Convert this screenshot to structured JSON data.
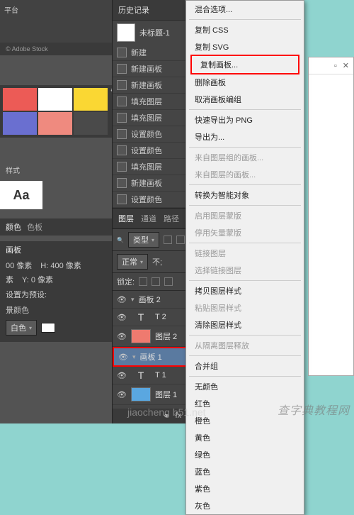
{
  "left": {
    "platform": "平台",
    "stock": "© Adobe Stock",
    "swatches": [
      "#ec5b56",
      "#ffffff",
      "#FAD733",
      "#6a6fd0",
      "#ef8a7f",
      "#4a4a4a"
    ],
    "fad_label": "#FAD733",
    "style_label": "样式",
    "aa": "Aa",
    "tabs_color": {
      "a": "颜色",
      "b": "色板"
    },
    "artboard_tab": "画板",
    "w_label": "00 像素",
    "h_label": "H: 400 像素",
    "x_label": "素",
    "y_label": "Y: 0 像素",
    "preset_label": "设置为预设:",
    "bg_label": "景颜色",
    "bg_value": "白色"
  },
  "history": {
    "title": "历史记录",
    "doc": "未标题-1",
    "items": [
      "新建",
      "新建画板",
      "新建画板",
      "填充图层",
      "填充图层",
      "设置颜色",
      "设置颜色",
      "填充图层",
      "新建画板",
      "设置颜色"
    ]
  },
  "layers": {
    "tabs": {
      "layer": "图层",
      "channel": "通道",
      "path": "路径"
    },
    "kind": "类型",
    "mode": "正常",
    "opacity_label": "不;",
    "lock": "锁定:",
    "items": [
      {
        "name": "画板 2",
        "type": "group"
      },
      {
        "name": "T 2",
        "type": "text"
      },
      {
        "name": "图层 2",
        "type": "layer",
        "color": "#ef7a6f"
      },
      {
        "name": "画板 1",
        "type": "group",
        "selected": true
      },
      {
        "name": "T 1",
        "type": "text"
      },
      {
        "name": "图层 1",
        "type": "layer",
        "color": "#5aa7e0"
      }
    ]
  },
  "ctx": {
    "items": [
      {
        "t": "混合选项...",
        "en": true
      },
      {
        "sep": true
      },
      {
        "t": "复制 CSS",
        "en": true
      },
      {
        "t": "复制 SVG",
        "en": true
      },
      {
        "t": "复制画板...",
        "en": true,
        "hl": true
      },
      {
        "t": "删除画板",
        "en": true
      },
      {
        "t": "取消画板编组",
        "en": true
      },
      {
        "sep": true
      },
      {
        "t": "快速导出为 PNG",
        "en": true
      },
      {
        "t": "导出为...",
        "en": true
      },
      {
        "sep": true
      },
      {
        "t": "来自图层组的画板...",
        "en": false
      },
      {
        "t": "来自图层的画板...",
        "en": false
      },
      {
        "sep": true
      },
      {
        "t": "转换为智能对象",
        "en": true
      },
      {
        "sep": true
      },
      {
        "t": "启用图层蒙版",
        "en": false
      },
      {
        "t": "停用矢量蒙版",
        "en": false
      },
      {
        "sep": true
      },
      {
        "t": "链接图层",
        "en": false
      },
      {
        "t": "选择链接图层",
        "en": false
      },
      {
        "sep": true
      },
      {
        "t": "拷贝图层样式",
        "en": true
      },
      {
        "t": "粘贴图层样式",
        "en": false
      },
      {
        "t": "清除图层样式",
        "en": true
      },
      {
        "sep": true
      },
      {
        "t": "从隔离图层释放",
        "en": false
      },
      {
        "sep": true
      },
      {
        "t": "合并组",
        "en": true
      },
      {
        "sep": true
      },
      {
        "t": "无颜色",
        "en": true
      },
      {
        "t": "红色",
        "en": true
      },
      {
        "t": "橙色",
        "en": true
      },
      {
        "t": "黄色",
        "en": true
      },
      {
        "t": "绿色",
        "en": true
      },
      {
        "t": "蓝色",
        "en": true
      },
      {
        "t": "紫色",
        "en": true
      },
      {
        "t": "灰色",
        "en": true
      }
    ]
  },
  "watermark": {
    "a": "查字典教程网",
    "b": "jiaocheng   b51.net"
  }
}
